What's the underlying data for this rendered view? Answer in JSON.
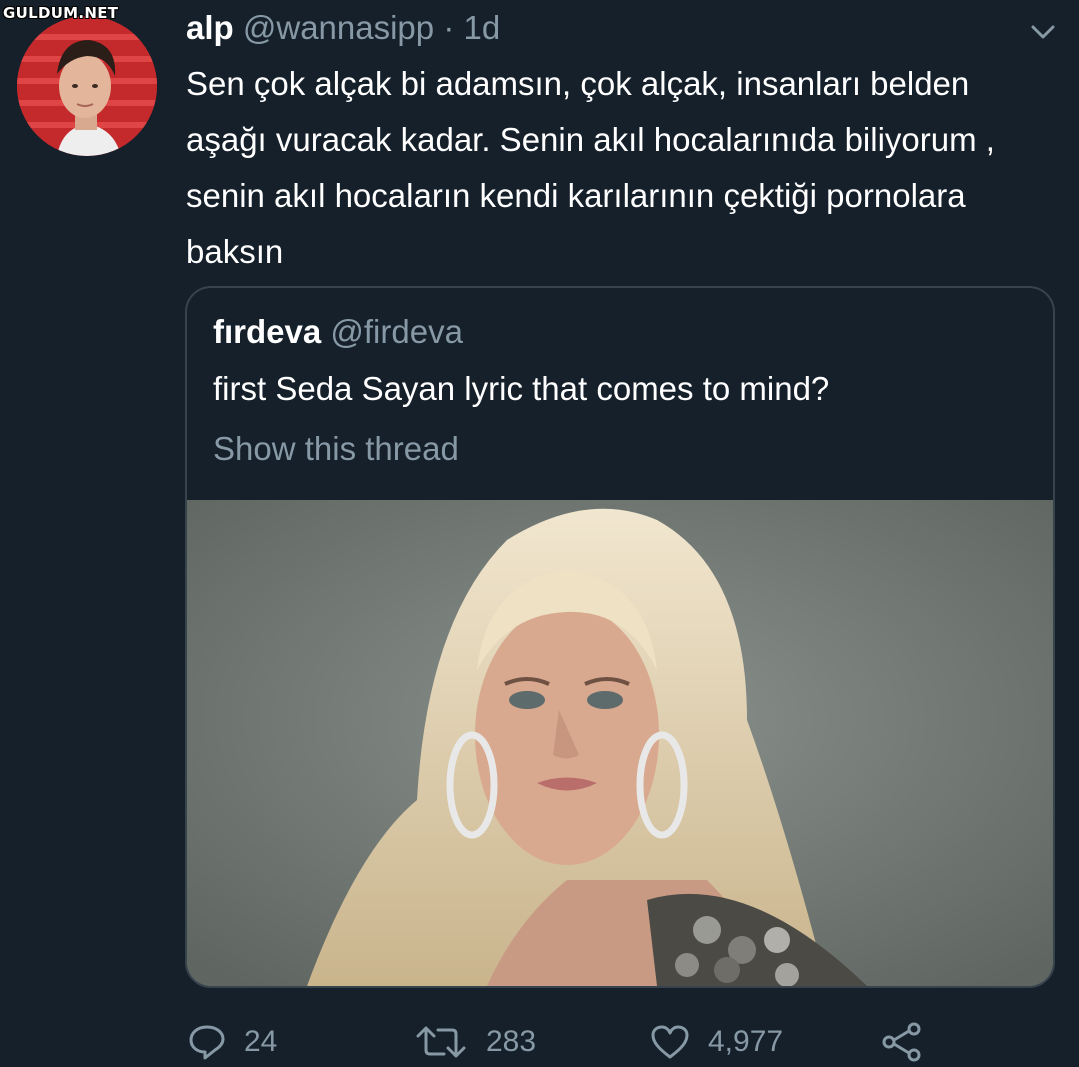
{
  "watermark": "GULDUM.NET",
  "tweet": {
    "name": "alp",
    "handle": "@wannasipp",
    "separator": "·",
    "time": "1d",
    "text": "Sen çok alçak bi adamsın, çok alçak, insanları belden aşağı vuracak kadar. Senin akıl hocalarınıda biliyorum , senin akıl hocaların kendi karılarının çektiği pornolara baksın"
  },
  "quoted": {
    "name": "fırdeva",
    "handle": "@firdeva",
    "text": "first Seda Sayan lyric that comes to mind?",
    "thread_link": "Show this thread"
  },
  "actions": {
    "reply_count": "24",
    "retweet_count": "283",
    "like_count": "4,977"
  },
  "icons": {
    "caret": "chevron-down-icon",
    "reply": "reply-icon",
    "retweet": "retweet-icon",
    "like": "heart-icon",
    "share": "share-icon"
  },
  "colors": {
    "background": "#15202b",
    "secondary_text": "#8899a6",
    "border": "#38444d",
    "text": "#ffffff"
  }
}
